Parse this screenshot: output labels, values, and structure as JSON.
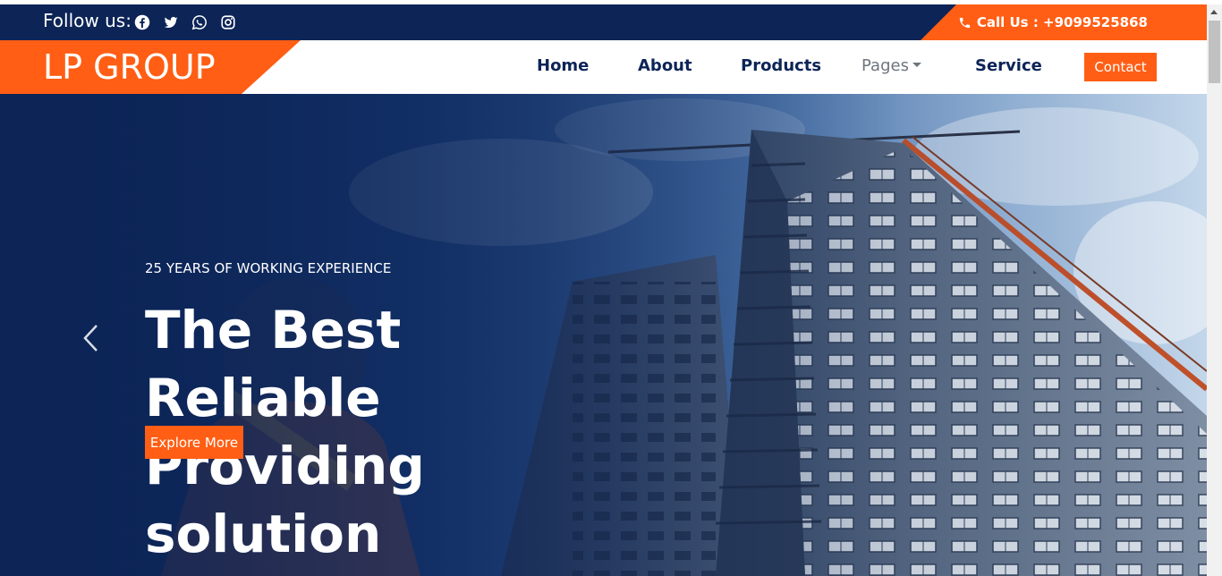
{
  "topbar": {
    "follow_label": "Follow us:",
    "socials": [
      "facebook-icon",
      "twitter-icon",
      "whatsapp-icon",
      "instagram-icon"
    ],
    "call_text": "Call Us : +9099525868"
  },
  "brand": {
    "name": "LP GROUP"
  },
  "nav": {
    "home": "Home",
    "about": "About",
    "products": "Products",
    "pages": "Pages",
    "service": "Service",
    "contact": "Contact"
  },
  "hero": {
    "subtitle": "25 YEARS OF WORKING EXPERIENCE",
    "title": "The Best Reliable Providing solution",
    "button": "Explore More"
  },
  "colors": {
    "accent": "#ff5e14",
    "navy": "#0c2456"
  }
}
